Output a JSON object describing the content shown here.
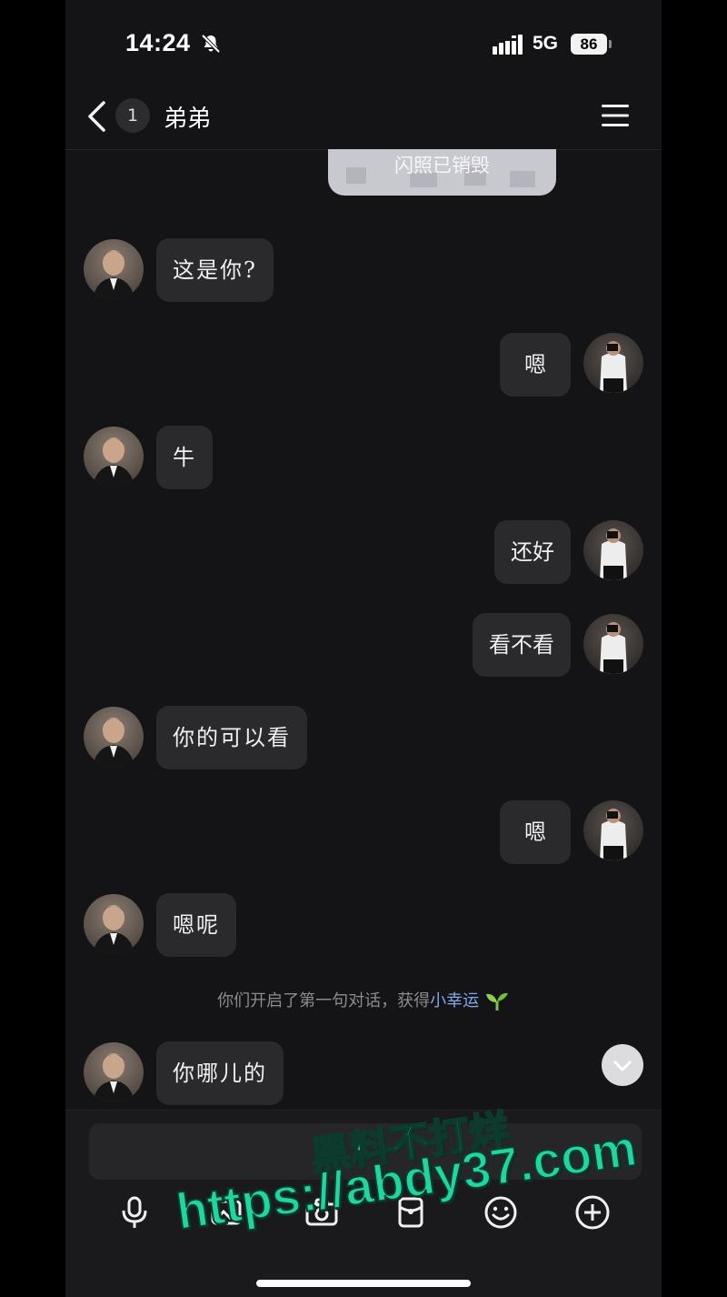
{
  "status_bar": {
    "time": "14:24",
    "network": "5G",
    "battery": "86"
  },
  "header": {
    "unread_count": "1",
    "title": "弟弟"
  },
  "flash": {
    "text": "闪照已销毁"
  },
  "messages": [
    {
      "side": "left",
      "text": "这是你?"
    },
    {
      "side": "right",
      "text": "嗯"
    },
    {
      "side": "left",
      "text": "牛"
    },
    {
      "side": "right",
      "text": "还好"
    },
    {
      "side": "right",
      "text": "看不看"
    },
    {
      "side": "left",
      "text": "你的可以看"
    },
    {
      "side": "right",
      "text": "嗯"
    },
    {
      "side": "left",
      "text": "嗯呢"
    },
    {
      "side": "left",
      "text": "你哪儿的"
    }
  ],
  "system_message": {
    "prefix": "你们开启了第一句对话，获得",
    "highlight": "小幸运"
  },
  "composer": {
    "placeholder": ""
  },
  "toolbar": [
    "mic-icon",
    "image-icon",
    "camera-icon",
    "red-packet-icon",
    "emoji-icon",
    "plus-icon"
  ],
  "watermark": {
    "line1": "黑料不打烊",
    "line2": "https://abdy37.com"
  },
  "colors": {
    "background": "#141416",
    "bubble": "#2a2a2d",
    "highlight": "#7fa8e8",
    "watermark": "#1fd6a0"
  }
}
